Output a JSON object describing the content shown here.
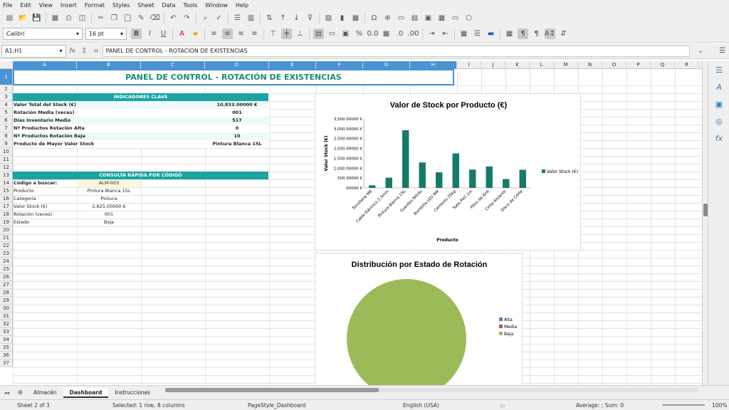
{
  "menu": [
    "File",
    "Edit",
    "View",
    "Insert",
    "Format",
    "Styles",
    "Sheet",
    "Data",
    "Tools",
    "Window",
    "Help"
  ],
  "font_name": "Calibri",
  "font_size": "16 pt",
  "namebox": "A1:H1",
  "formula": "PANEL DE CONTROL - ROTACIÓN DE EXISTENCIAS",
  "columns": [
    "A",
    "B",
    "C",
    "D",
    "E",
    "F",
    "G",
    "H",
    "I",
    "J",
    "K",
    "L",
    "M",
    "N",
    "O",
    "P",
    "Q",
    "R"
  ],
  "rows": [
    "1",
    "2",
    "3",
    "4",
    "5",
    "6",
    "7",
    "8",
    "9",
    "10",
    "11",
    "12",
    "13",
    "14",
    "15",
    "16",
    "17",
    "18",
    "19",
    "20",
    "21",
    "22",
    "23",
    "24",
    "25",
    "26",
    "27",
    "28",
    "29",
    "30",
    "31",
    "32",
    "33",
    "34",
    "35",
    "36",
    "37"
  ],
  "title": "PANEL DE CONTROL - ROTACIÓN DE EXISTENCIAS",
  "kpi_header": "INDICADORES CLAVE",
  "kpis": [
    {
      "label": "Valor Total del Stock (€)",
      "value": "10,833.00000 €"
    },
    {
      "label": "Rotación Media (veces)",
      "value": "001"
    },
    {
      "label": "Días Inventario Medio",
      "value": "517"
    },
    {
      "label": "Nº Productos Rotación Alta",
      "value": "0"
    },
    {
      "label": "Nº Productos Rotación Baja",
      "value": "10"
    },
    {
      "label": "Producto de Mayor Valor Stock",
      "value": "Pintura Blanca 15L"
    }
  ],
  "lookup_header": "CONSULTA RÁPIDA POR CÓDIGO",
  "lookup": [
    {
      "label": "Código a buscar:",
      "value": "ALM-003"
    },
    {
      "label": "Producto",
      "value": "Pintura Blanca 15L"
    },
    {
      "label": "Categoría",
      "value": "Pintura"
    },
    {
      "label": "Valor Stock (€)",
      "value": "2,925.00000 €"
    },
    {
      "label": "Rotación (veces)",
      "value": "001"
    },
    {
      "label": "Estado",
      "value": "Baja"
    }
  ],
  "chart_data": [
    {
      "type": "bar",
      "title": "Valor de Stock por Producto (€)",
      "xlabel": "Producto",
      "ylabel": "Valor Stock (€)",
      "ylim": [
        0,
        3500
      ],
      "yticks": [
        "3,500.00000 €",
        "3,000.00000 €",
        "2,500.00000 €",
        "2,000.00000 €",
        "1,500.00000 €",
        "1,000.00000 €",
        "500.00000 €",
        ".00000 €"
      ],
      "categories": [
        "Tornillería M8",
        "Cable Eléctrico 2.5mm",
        "Pintura Blanca 15L",
        "Guantes Nitrilo",
        "Bombilla LED 9W",
        "Cemento 25kg",
        "Tubo PVC 1m",
        "Filtro de Aire",
        "Cinta Aislante",
        "Disco de Corte"
      ],
      "series": [
        {
          "name": "Valor Stock (€)",
          "values": [
            130,
            520,
            2925,
            1290,
            790,
            1750,
            930,
            1090,
            450,
            920
          ]
        }
      ],
      "color": "#167a6a",
      "legend": "right"
    },
    {
      "type": "pie",
      "title": "Distribución por Estado de Rotación",
      "categories": [
        "Alta",
        "Media",
        "Baja"
      ],
      "values": [
        0,
        0,
        10
      ],
      "colors": [
        "#4f81bd",
        "#c0504d",
        "#9bbb59"
      ],
      "legend": "right"
    }
  ],
  "tabs": [
    "Almacén",
    "Dashboard",
    "Instrucciones"
  ],
  "active_tab": "Dashboard",
  "status": {
    "sheet": "Sheet 2 of 3",
    "selection": "Selected: 1 row, 8 columns",
    "pagestyle": "PageStyle_Dashboard",
    "language": "English (USA)",
    "sum": "Average: ; Sum: 0",
    "zoom": "100%"
  }
}
